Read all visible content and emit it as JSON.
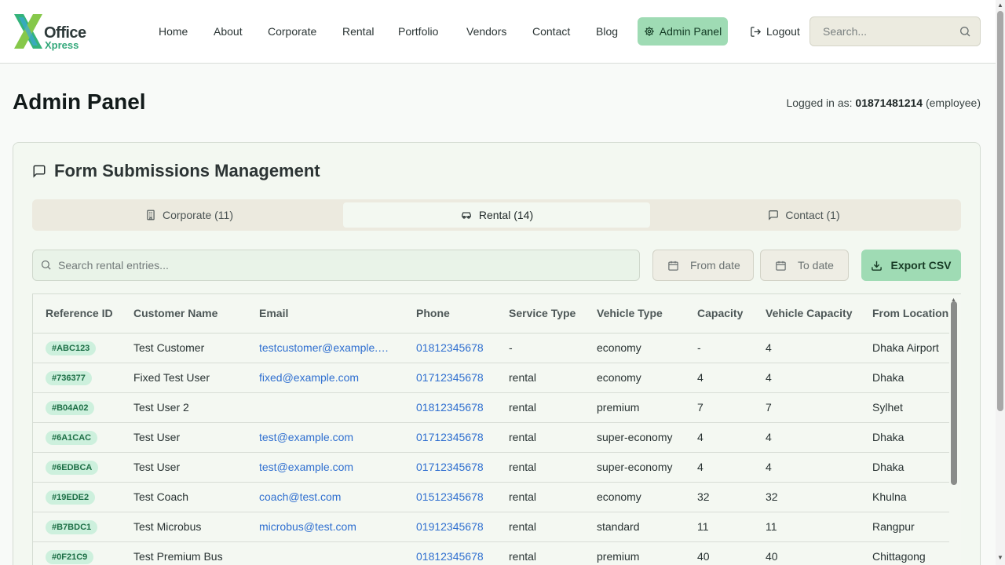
{
  "brand": {
    "line1": "Office",
    "line2": "Xpress"
  },
  "nav": [
    "Home",
    "About",
    "Corporate",
    "Rental",
    "Portfolio",
    "Vendors",
    "Contact",
    "Blog"
  ],
  "admin_button": "Admin Panel",
  "logout": "Logout",
  "search": {
    "placeholder": "Search..."
  },
  "page": {
    "title": "Admin Panel",
    "logged_prefix": "Logged in as:",
    "logged_user": "01871481214",
    "logged_role": "(employee)"
  },
  "card": {
    "title": "Form Submissions Management",
    "tabs": [
      "Corporate (11)",
      "Rental (14)",
      "Contact (1)"
    ],
    "filter_placeholder": "Search rental entries...",
    "from_date": "From date",
    "to_date": "To date",
    "export": "Export CSV"
  },
  "table": {
    "columns": [
      "Reference ID",
      "Customer Name",
      "Email",
      "Phone",
      "Service Type",
      "Vehicle Type",
      "Capacity",
      "Vehicle Capacity",
      "From Location"
    ],
    "rows": [
      [
        "#ABC123",
        "Test Customer",
        "testcustomer@example.…",
        "01812345678",
        "-",
        "economy",
        "-",
        "4",
        "Dhaka Airport"
      ],
      [
        "#736377",
        "Fixed Test User",
        "fixed@example.com",
        "01712345678",
        "rental",
        "economy",
        "4",
        "4",
        "Dhaka"
      ],
      [
        "#B04A02",
        "Test User 2",
        "",
        "01812345678",
        "rental",
        "premium",
        "7",
        "7",
        "Sylhet"
      ],
      [
        "#6A1CAC",
        "Test User",
        "test@example.com",
        "01712345678",
        "rental",
        "super-economy",
        "4",
        "4",
        "Dhaka"
      ],
      [
        "#6EDBCA",
        "Test User",
        "test@example.com",
        "01712345678",
        "rental",
        "super-economy",
        "4",
        "4",
        "Dhaka"
      ],
      [
        "#19EDE2",
        "Test Coach",
        "coach@test.com",
        "01512345678",
        "rental",
        "economy",
        "32",
        "32",
        "Khulna"
      ],
      [
        "#B7BDC1",
        "Test Microbus",
        "microbus@test.com",
        "01912345678",
        "rental",
        "standard",
        "11",
        "11",
        "Rangpur"
      ],
      [
        "#0F21C9",
        "Test Premium Bus",
        "",
        "01812345678",
        "rental",
        "premium",
        "40",
        "40",
        "Chittagong"
      ]
    ]
  },
  "colors": {
    "accent": "#9fdbb4",
    "link": "#2f6fd0",
    "badge_bg": "#cdf0dd",
    "badge_text": "#1c6e45"
  }
}
